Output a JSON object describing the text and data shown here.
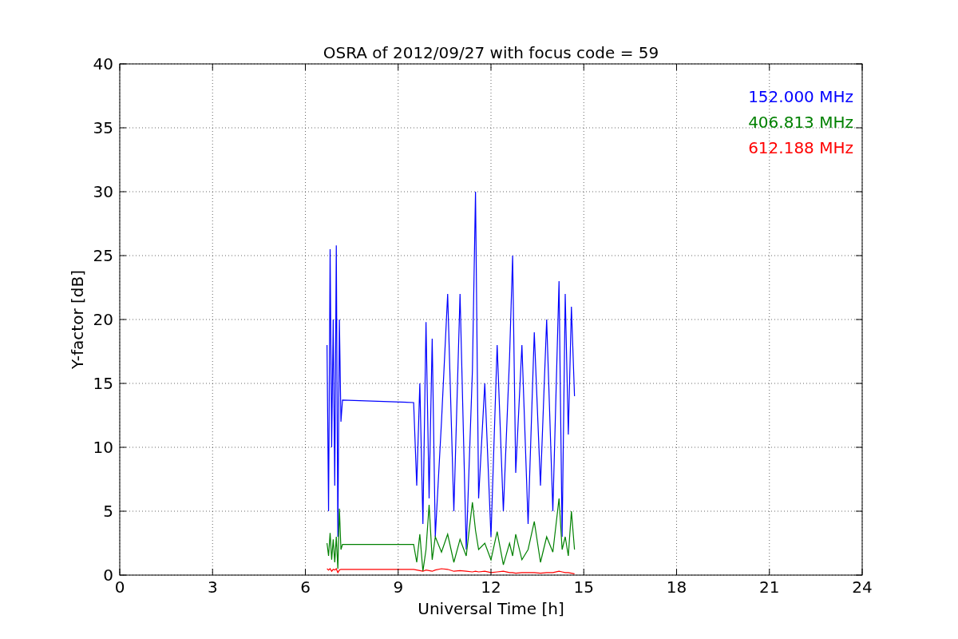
{
  "chart_data": {
    "type": "line",
    "grid": true,
    "title": "OSRA of 2012/09/27 with focus code = 59",
    "xlabel": "Universal Time [h]",
    "ylabel": "Y-factor [dB]",
    "xlim": [
      0,
      24
    ],
    "ylim": [
      0,
      40
    ],
    "xticks": [
      0,
      3,
      6,
      9,
      12,
      15,
      18,
      21,
      24
    ],
    "yticks": [
      0,
      5,
      10,
      15,
      20,
      25,
      30,
      35,
      40
    ],
    "x": [
      6.7,
      6.75,
      6.8,
      6.85,
      6.9,
      6.95,
      7.0,
      7.05,
      7.1,
      7.15,
      7.2,
      9.5,
      9.6,
      9.7,
      9.8,
      9.9,
      10.0,
      10.1,
      10.2,
      10.4,
      10.6,
      10.8,
      11.0,
      11.2,
      11.4,
      11.5,
      11.6,
      11.8,
      12.0,
      12.2,
      12.4,
      12.6,
      12.7,
      12.8,
      13.0,
      13.2,
      13.4,
      13.6,
      13.8,
      14.0,
      14.2,
      14.3,
      14.4,
      14.5,
      14.6,
      14.7
    ],
    "series": [
      {
        "name": "152.000 MHz",
        "color": "#0000ff",
        "values": [
          18,
          5,
          25.5,
          10,
          20,
          7,
          25.8,
          3,
          20,
          12,
          13.7,
          13.5,
          7,
          15,
          4,
          19.8,
          6,
          18.5,
          3,
          12,
          22,
          5,
          22,
          2,
          16,
          30,
          6,
          15,
          3,
          18,
          5,
          17,
          25,
          8,
          18,
          4,
          19,
          7,
          20,
          5,
          23,
          3,
          22,
          11,
          21,
          14
        ]
      },
      {
        "name": "406.813 MHz",
        "color": "#008000",
        "values": [
          2.5,
          1.5,
          3.3,
          1.2,
          2.8,
          1.0,
          3.0,
          0.5,
          5.2,
          2.0,
          2.4,
          2.4,
          1.0,
          3.2,
          0.3,
          2.0,
          5.5,
          1.2,
          3.0,
          1.8,
          3.2,
          1.0,
          2.8,
          1.5,
          5.7,
          3.5,
          2.0,
          2.5,
          1.2,
          3.4,
          0.8,
          2.5,
          1.5,
          3.2,
          1.2,
          2.0,
          4.2,
          1.0,
          3.0,
          1.8,
          6.0,
          2.0,
          3.0,
          1.5,
          5.0,
          2.0
        ]
      },
      {
        "name": "612.188 MHz",
        "color": "#ff0000",
        "values": [
          0.5,
          0.4,
          0.5,
          0.3,
          0.45,
          0.4,
          0.5,
          0.2,
          0.4,
          0.45,
          0.45,
          0.45,
          0.4,
          0.35,
          0.3,
          0.4,
          0.35,
          0.3,
          0.4,
          0.5,
          0.45,
          0.3,
          0.35,
          0.3,
          0.25,
          0.3,
          0.25,
          0.3,
          0.2,
          0.25,
          0.3,
          0.2,
          0.2,
          0.15,
          0.2,
          0.2,
          0.2,
          0.15,
          0.2,
          0.2,
          0.3,
          0.25,
          0.2,
          0.2,
          0.15,
          0.1
        ]
      }
    ]
  }
}
